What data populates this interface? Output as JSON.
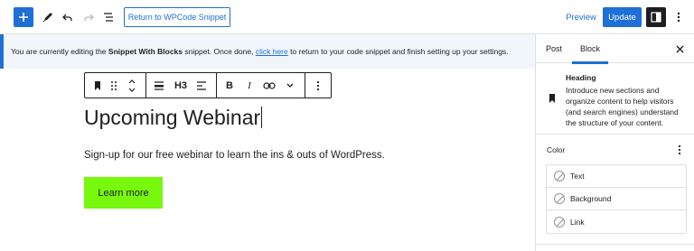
{
  "topbar": {
    "return_label": "Return to WPCode Snippet",
    "preview_label": "Preview",
    "update_label": "Update"
  },
  "notice": {
    "prefix": "You are currently editing the ",
    "snippet_name": "Snippet With Blocks",
    "middle": " snippet. Once done, ",
    "link_text": "click here",
    "suffix": " to return to your code snippet and finish setting up your settings."
  },
  "block_toolbar": {
    "heading_level": "H3"
  },
  "canvas": {
    "heading": "Upcoming Webinar",
    "paragraph": "Sign-up for our free webinar to learn the ins & outs of WordPress.",
    "button_label": "Learn more",
    "button_color": "#77f80d"
  },
  "sidebar": {
    "tabs": [
      {
        "label": "Post"
      },
      {
        "label": "Block"
      }
    ],
    "block_card": {
      "title": "Heading",
      "description": "Introduce new sections and organize content to help visitors (and search engines) understand the structure of your content."
    },
    "color_panel": {
      "title": "Color",
      "items": [
        {
          "label": "Text"
        },
        {
          "label": "Background"
        },
        {
          "label": "Link"
        }
      ]
    }
  },
  "colors": {
    "accent": "#1e6fd6",
    "dark": "#1e1e1e",
    "notice_bg": "#f0f6fc"
  }
}
